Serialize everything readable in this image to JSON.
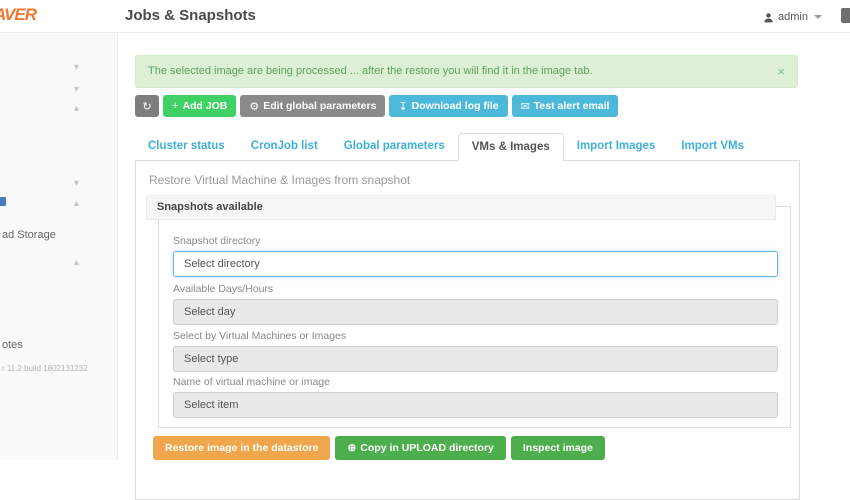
{
  "colors": {
    "logo_orange": "#f07830",
    "bright_green_button": "#3fd163",
    "gray_button": "#8a8a8a",
    "blue_button": "#4cb9db",
    "orange_button": "#f0a64c",
    "green_button": "#4cae4c",
    "alert_background": "#ddf0d5",
    "alert_text": "#5ba35b",
    "tab_link": "#3fb0d8",
    "focused_input_border": "#6cb2e4"
  },
  "icons": {
    "refresh": "↻",
    "plus": "+",
    "gear": "⚙",
    "download": "↧",
    "email": "✉",
    "copy": "⊕",
    "close": "×",
    "caret_down": "▾",
    "caret_up": "▴"
  },
  "header": {
    "logo": "AVER",
    "title": "Jobs & Snapshots",
    "user": "admin"
  },
  "sidebar": {
    "storage_fragment": "ad Storage",
    "notes_fragment": "otes",
    "version_fragment": "r 11.2 build 1802131232"
  },
  "alert": {
    "message": "The selected image are being processed ... after the restore you will find it in the image tab."
  },
  "toolbar": {
    "add_job": "Add JOB",
    "edit_global": "Edit global parameters",
    "download_log": "Download log file",
    "test_alert": "Test alert email"
  },
  "tabs": [
    {
      "label": "Cluster status",
      "active": false
    },
    {
      "label": "CronJob list",
      "active": false
    },
    {
      "label": "Global parameters",
      "active": false
    },
    {
      "label": "VMs & Images",
      "active": true
    },
    {
      "label": "Import Images",
      "active": false
    },
    {
      "label": "Import VMs",
      "active": false
    }
  ],
  "panel": {
    "description": "Restore Virtual Machine & Images from snapshot",
    "heading": "Snapshots available",
    "fields": [
      {
        "label": "Snapshot directory",
        "value": "Select directory",
        "state": "active"
      },
      {
        "label": "Available Days/Hours",
        "value": "Select day",
        "state": "disabled"
      },
      {
        "label": "Select by Virtual Machines or Images",
        "value": "Select type",
        "state": "disabled"
      },
      {
        "label": "Name of virtual machine or image",
        "value": "Select item",
        "state": "disabled"
      }
    ],
    "actions": [
      {
        "label": "Restore image in the datastore",
        "style": "orange"
      },
      {
        "label": "Copy in UPLOAD directory",
        "style": "green"
      },
      {
        "label": "Inspect image",
        "style": "green"
      }
    ]
  }
}
